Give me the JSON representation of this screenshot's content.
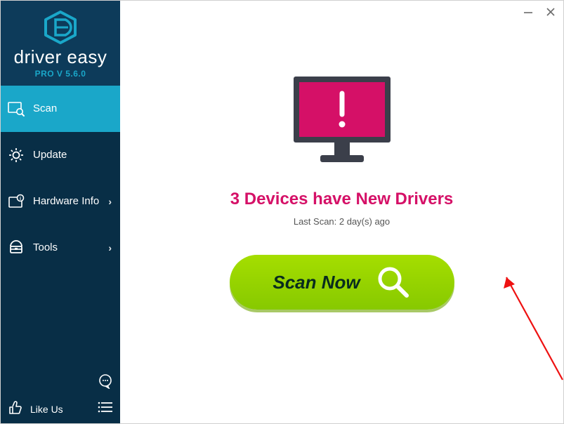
{
  "brand": {
    "name": "driver easy",
    "version_label": "PRO V 5.6.0"
  },
  "sidebar": {
    "items": [
      {
        "label": "Scan",
        "icon": "scan-icon",
        "active": true,
        "has_sub": false
      },
      {
        "label": "Update",
        "icon": "gear-icon",
        "active": false,
        "has_sub": false
      },
      {
        "label": "Hardware Info",
        "icon": "hwinfo-icon",
        "active": false,
        "has_sub": true
      },
      {
        "label": "Tools",
        "icon": "toolbox-icon",
        "active": false,
        "has_sub": true
      }
    ],
    "like_label": "Like Us"
  },
  "main": {
    "headline": "3 Devices have New Drivers",
    "subline": "Last Scan: 2 day(s) ago",
    "scan_button": "Scan Now"
  },
  "colors": {
    "accent": "#1aa7c9",
    "alert": "#d51067",
    "action": "#95d400"
  }
}
